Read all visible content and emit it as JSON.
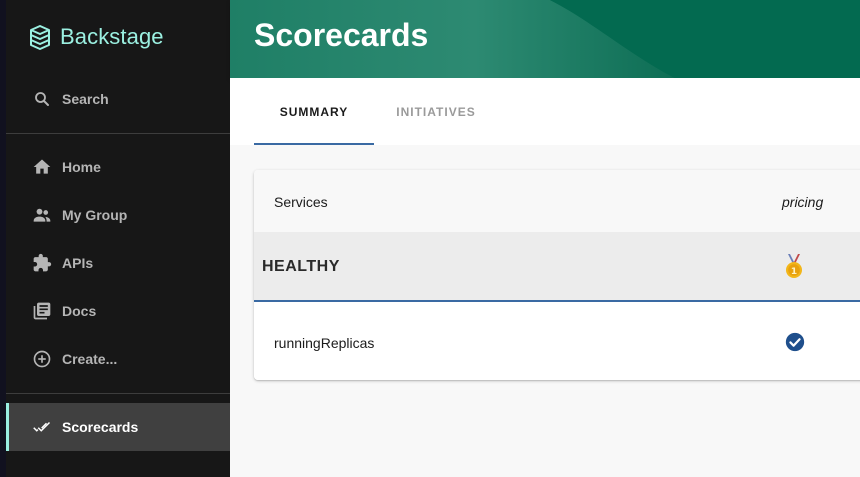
{
  "app": {
    "logo_text": "Backstage"
  },
  "sidebar": {
    "search_label": "Search",
    "items": [
      {
        "label": "Home",
        "icon": "home-icon"
      },
      {
        "label": "My Group",
        "icon": "group-icon"
      },
      {
        "label": "APIs",
        "icon": "puzzle-icon"
      },
      {
        "label": "Docs",
        "icon": "docs-icon"
      },
      {
        "label": "Create...",
        "icon": "add-circle-icon"
      }
    ],
    "active_item": {
      "label": "Scorecards",
      "icon": "double-check-icon"
    }
  },
  "header": {
    "title": "Scorecards"
  },
  "tabs": [
    {
      "label": "SUMMARY",
      "selected": true
    },
    {
      "label": "INITIATIVES",
      "selected": false
    }
  ],
  "table": {
    "col_services": "Services",
    "col_pricing": "pricing",
    "group_label": "HEALTHY",
    "group_badge_icon": "medal-icon",
    "rows": [
      {
        "label": "runningReplicas",
        "status_icon": "check-circle-icon"
      }
    ]
  },
  "colors": {
    "accent": "#9bf0e1",
    "header_bg": "#00694f",
    "sidebar_bg": "#171717",
    "tab_indicator": "#3a6aa3",
    "check": "#1f4f8c"
  }
}
